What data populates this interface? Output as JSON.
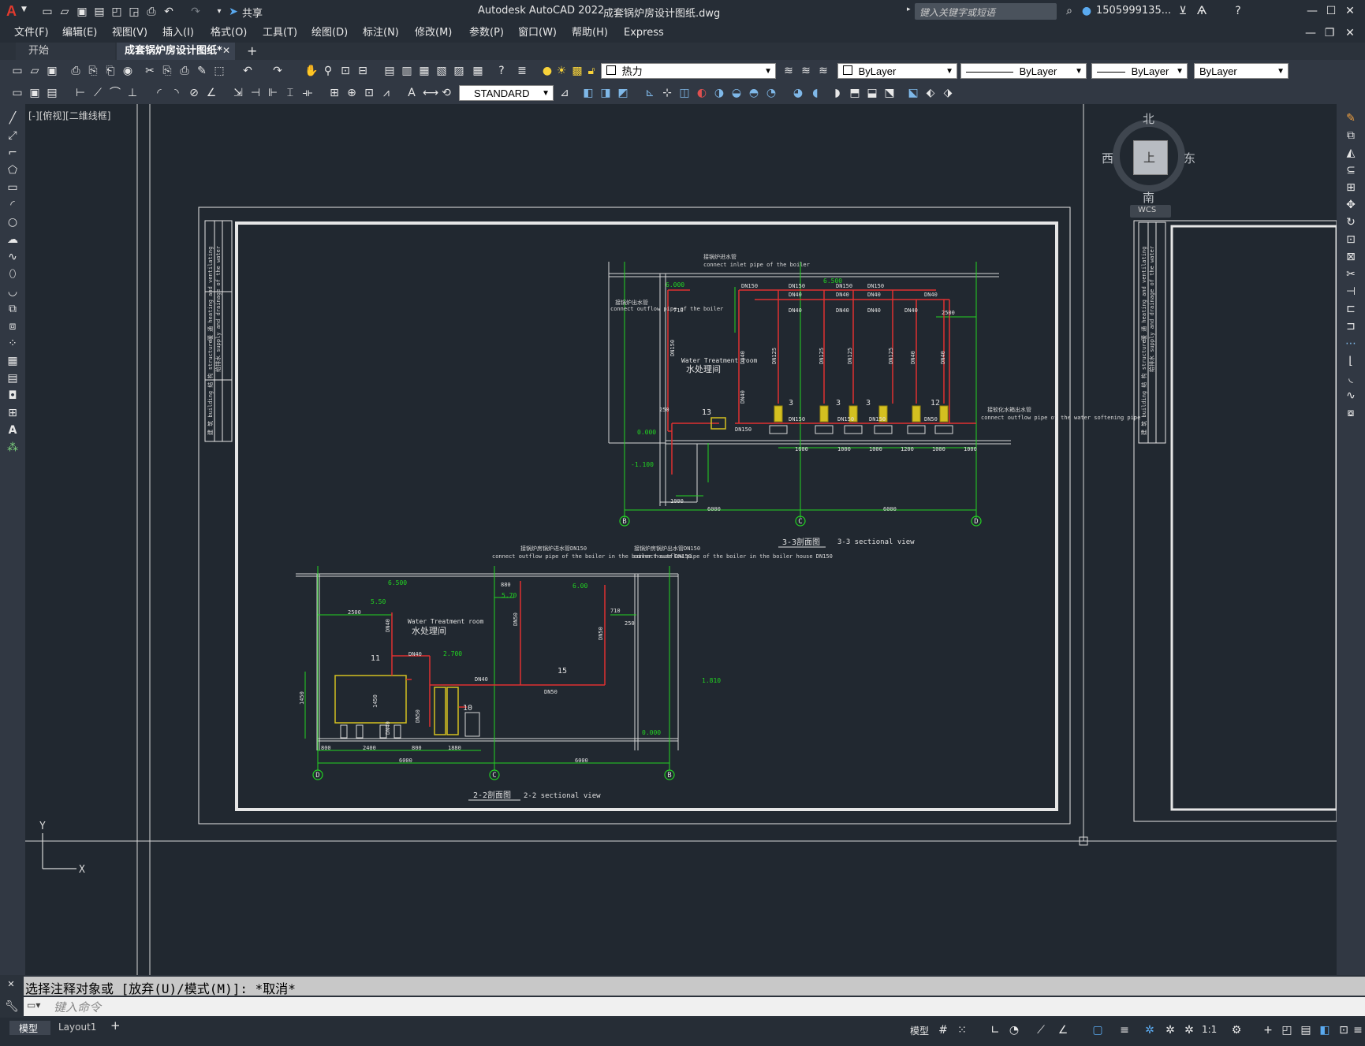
{
  "app": {
    "title": "Autodesk AutoCAD 2022",
    "document": "成套锅炉房设计图纸.dwg",
    "share": "共享",
    "search_placeholder": "键入关键字或短语",
    "user": "1505999135...",
    "logo": "A"
  },
  "menu": [
    "文件(F)",
    "编辑(E)",
    "视图(V)",
    "插入(I)",
    "格式(O)",
    "工具(T)",
    "绘图(D)",
    "标注(N)",
    "修改(M)",
    "参数(P)",
    "窗口(W)",
    "帮助(H)",
    "Express"
  ],
  "tabs": [
    {
      "label": "开始",
      "active": false
    },
    {
      "label": "成套锅炉房设计图纸*",
      "active": true
    }
  ],
  "toolbar": {
    "layer": "热力",
    "color": "ByLayer",
    "linetype": "ByLayer",
    "lineweight": "ByLayer",
    "plotstyle": "ByLayer",
    "textstyle": "STANDARD"
  },
  "viewport": {
    "label": "[-][俯视][二维线框]"
  },
  "viewcube": {
    "north": "北",
    "south": "南",
    "east": "东",
    "west": "西",
    "face": "上",
    "wcs": "WCS"
  },
  "ucs": {
    "x": "X",
    "y": "Y"
  },
  "drawing": {
    "title_3_3_cn": "3-3剖面图",
    "title_3_3_en": "3-3 sectional view",
    "title_2_2_cn": "2-2剖面图",
    "title_2_2_en": "2-2 sectional view",
    "room_en": "Water Treatment room",
    "room_cn": "水处理间",
    "elev_6000": "6.000",
    "elev_6500": "6.500",
    "elev_000": "0.000",
    "elev_m1100": "-1.100",
    "elev_550": "5.50",
    "elev_570": "5.70",
    "elev_600": "6.00",
    "elev_2700": "2.700",
    "elev_1810": "1.810",
    "axis_b": "B",
    "axis_c": "C",
    "axis_d": "D",
    "dim_6000": "6000",
    "dim_1000": "1000",
    "dim_1600": "1600",
    "dim_1200": "1200",
    "dim_2500": "2500",
    "dim_2400": "2400",
    "dim_800": "800",
    "dim_1880": "1880",
    "dim_1450": "1450",
    "dim_710": "710",
    "dim_250": "250",
    "dim_880": "880",
    "dn150": "DN150",
    "dn125": "DN125",
    "dn40": "DN40",
    "dn50": "DN50",
    "n3": "3",
    "n10": "10",
    "n11": "11",
    "n12": "12",
    "n13": "13",
    "n15": "15",
    "note_inlet_cn": "接锅炉进水管",
    "note_inlet_en": "connect inlet pipe of the boiler",
    "note_out_cn": "接锅炉出水管",
    "note_out_en": "connect outflow pipe of the boiler",
    "note_soft_cn": "接软化水箱出水管",
    "note_soft_en": "connect outflow pipe of the water softening pipe",
    "note_house_cn": "接锅炉房锅炉进水管DN150",
    "note_house_en": "connect outflow pipe of the boiler in the boiler house DN150",
    "note_house2_cn": "接锅炉房锅炉出水管DN150",
    "sheet_side": "暖 通 heating and ventilating",
    "sheet_side2": "给排水 supply and drainage of the water",
    "sheet_side3": "建 筑 building  结 构 structure"
  },
  "command": {
    "history": "选择注释对象或 [放弃(U)/模式(M)]: *取消*",
    "placeholder": "键入命令"
  },
  "status": {
    "tab_model": "模型",
    "tab_layout": "Layout1",
    "model": "模型",
    "scale": "1:1"
  }
}
